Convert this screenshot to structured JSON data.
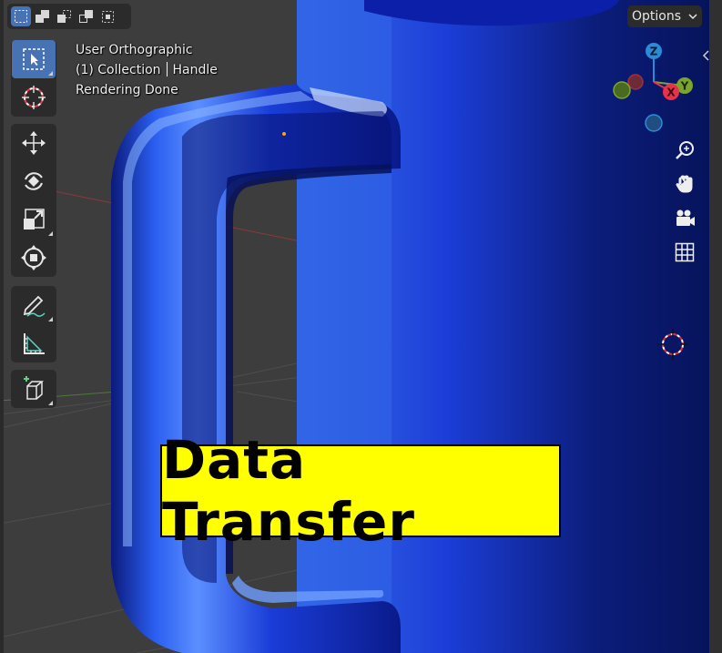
{
  "header": {
    "options_label": "Options",
    "select_modes": [
      "select-box-icon",
      "extend-icon",
      "subtract-icon",
      "difference-icon",
      "intersect-icon"
    ]
  },
  "overlay": {
    "view_name": "User Orthographic",
    "collection": "(1) Collection",
    "object": "Handle",
    "status": "Rendering Done"
  },
  "toolbar": {
    "tools": [
      "select-box",
      "cursor",
      "move",
      "rotate",
      "scale",
      "transform",
      "annotate",
      "measure",
      "add-cube"
    ]
  },
  "gizmo": {
    "z_label": "Z",
    "y_label": "Y",
    "x_label": "X",
    "colors": {
      "x": "#e8314a",
      "y": "#7ba62d",
      "z": "#2c8bd6"
    }
  },
  "banner": {
    "text": "Data Transfer"
  },
  "colors": {
    "accent": "#4772b3",
    "banner_bg": "#ffff00",
    "mesh": "#1d3fc8"
  }
}
